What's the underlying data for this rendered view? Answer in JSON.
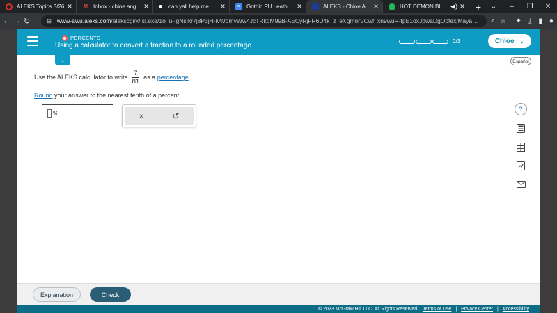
{
  "browser": {
    "tabs": [
      {
        "title": "ALEKS Topics 3/26",
        "favicon_color": "#d93025",
        "active": false
      },
      {
        "title": "Inbox - chloe.angst@s",
        "favicon_color": "#ea4335",
        "active": false
      },
      {
        "title": "can yall help me with th",
        "favicon_color": "#ffffff",
        "active": false
      },
      {
        "title": "Gothic PU Leather Hea",
        "favicon_color": "#4285f4",
        "active": false
      },
      {
        "title": "ALEKS - Chloe Angst - L",
        "favicon_color": "#1a3d8f",
        "active": true
      },
      {
        "title": "HOT DEMON BITCH",
        "favicon_color": "#1db954",
        "active": false
      }
    ],
    "new_tab": "+",
    "url_host": "www-awu.aleks.com",
    "url_path": "/alekscgi/x/Isl.exe/1o_u-IgNsIkr7j8P3jH-lvWqmvWw4JcTRkqM99B-AECyRjFR6U4k_z_eXgmorVCwf_xn9wuR-fpE1oxJpwaDgOpfexjMayaqws..."
  },
  "header": {
    "topic_label": "PERCENTS",
    "topic_title": "Using a calculator to convert a fraction to a rounded percentage",
    "progress_text": "0/3",
    "progress_fraction": 0,
    "user_name": "Chloe"
  },
  "language_button": "Español",
  "question": {
    "prefix": "Use the ALEKS calculator to write",
    "numerator": "7",
    "denominator": "81",
    "middle": "as a",
    "link_word": "percentage",
    "end_punct": ".",
    "round_link": "Round",
    "instruction_rest": "your answer to the nearest tenth of a percent."
  },
  "answer": {
    "value": "",
    "unit": "%"
  },
  "calculator": {
    "clear_symbol": "×",
    "undo_symbol": "↺"
  },
  "side_tools": [
    "help-icon",
    "calculator-icon",
    "periodic-table-icon",
    "textbook-icon",
    "message-icon"
  ],
  "help_symbol": "?",
  "footer": {
    "explanation_label": "Explanation",
    "check_label": "Check",
    "copyright": "© 2023 McGraw Hill LLC. All Rights Reserved.",
    "terms": "Terms of Use",
    "privacy": "Privacy Center",
    "accessibility": "Accessibility",
    "separator": "|"
  }
}
